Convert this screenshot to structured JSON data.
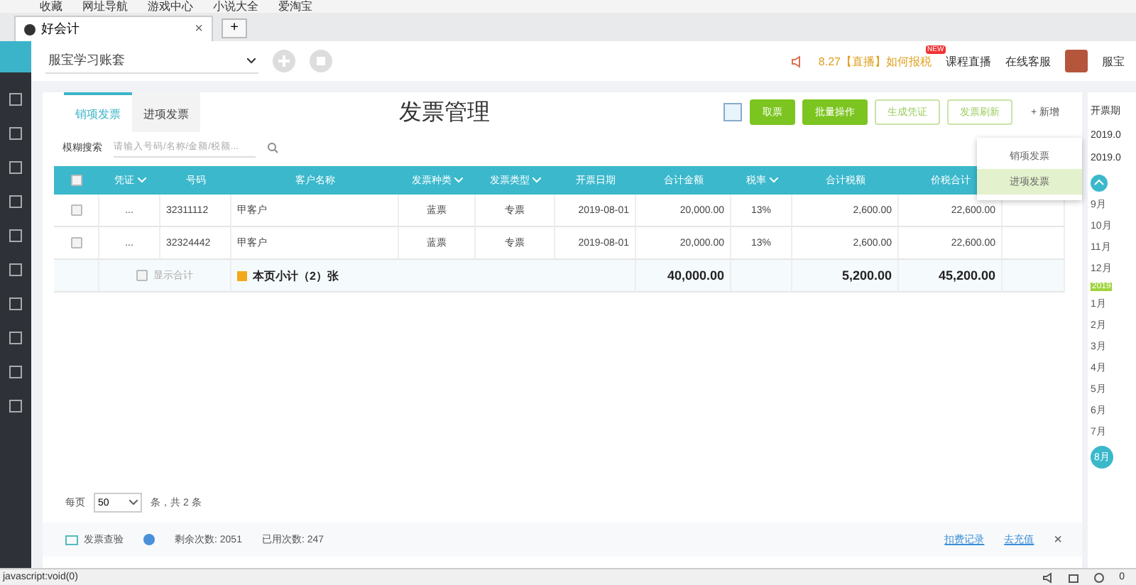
{
  "bookmarks": [
    "收藏",
    "网址导航",
    "游戏中心",
    "小说大全",
    "爱淘宝"
  ],
  "browser_tab": {
    "title": "好会计",
    "close": "×",
    "new_tab": "+"
  },
  "header": {
    "account": "服宝学习账套",
    "notice": "8.27【直播】如何报税",
    "course_badge": "NEW",
    "course": "课程直播",
    "service": "在线客服",
    "user": "服宝"
  },
  "invoice_tabs": [
    {
      "label": "销项发票",
      "selected": true
    },
    {
      "label": "进项发票",
      "selected": false
    }
  ],
  "title": "发票管理",
  "toolbar": [
    {
      "label": "取票",
      "kind": "primary"
    },
    {
      "label": "批量操作",
      "kind": "primary"
    },
    {
      "label": "生成凭证",
      "kind": "outline"
    },
    {
      "label": "发票刷新",
      "kind": "outline"
    },
    {
      "label": "+ 新增",
      "kind": "text"
    }
  ],
  "new_menu": [
    {
      "label": "销项发票",
      "selected": false
    },
    {
      "label": "进项发票",
      "selected": true
    }
  ],
  "search": {
    "mode": "模糊搜索",
    "placeholder": "请输入号码/名称/金额/税额..."
  },
  "table": {
    "select_all_checked": false,
    "columns": [
      {
        "kind": "check"
      },
      {
        "label": "凭证",
        "kind": "text",
        "dropdown": true
      },
      {
        "label": "号码",
        "kind": "text",
        "dropdown": false
      },
      {
        "label": "客户名称",
        "kind": "text",
        "dropdown": false
      },
      {
        "label": "发票种类",
        "kind": "text",
        "dropdown": true
      },
      {
        "label": "发票类型",
        "kind": "text",
        "dropdown": true
      },
      {
        "label": "开票日期",
        "kind": "text",
        "dropdown": false
      },
      {
        "label": "合计金额",
        "kind": "text",
        "dropdown": false
      },
      {
        "label": "税率",
        "kind": "text",
        "dropdown": true
      },
      {
        "label": "合计税额",
        "kind": "text",
        "dropdown": false
      },
      {
        "label": "价税合计",
        "kind": "text",
        "dropdown": false
      },
      {
        "kind": "blank"
      }
    ],
    "rows": [
      {
        "checked": false,
        "voucher": "...",
        "number": "32311112",
        "customer": "甲客户",
        "category": "蓝票",
        "type": "专票",
        "date": "2019-08-01",
        "amount": "20,000.00",
        "rate": "13%",
        "tax": "2,600.00",
        "total": "22,600.00"
      },
      {
        "checked": false,
        "voucher": "...",
        "number": "32324442",
        "customer": "甲客户",
        "category": "蓝票",
        "type": "专票",
        "date": "2019-08-01",
        "amount": "20,000.00",
        "rate": "13%",
        "tax": "2,600.00",
        "total": "22,600.00"
      }
    ],
    "subtotal": {
      "show_total": {
        "label": "显示合计",
        "checked": false
      },
      "label": "本页小计（2）张",
      "amount": "40,000.00",
      "tax": "5,200.00",
      "total": "45,200.00"
    }
  },
  "pagination": {
    "per_page_label": "每页",
    "per_page": "50",
    "summary": "条，共 2 条"
  },
  "verify_bar": {
    "title": "发票查验",
    "remaining": "剩余次数: 2051",
    "used": "已用次数: 247",
    "links": [
      "扣费记录",
      "去充值"
    ],
    "close": "×"
  },
  "period": {
    "label": "开票期",
    "dates": [
      "2019.0",
      "2019.0"
    ],
    "timeline": [
      {
        "kind": "month",
        "label": "9月",
        "selected": false
      },
      {
        "kind": "month",
        "label": "10月",
        "selected": false
      },
      {
        "kind": "month",
        "label": "11月",
        "selected": false
      },
      {
        "kind": "month",
        "label": "12月",
        "selected": false
      },
      {
        "kind": "year",
        "label": "2019"
      },
      {
        "kind": "month",
        "label": "1月",
        "selected": false
      },
      {
        "kind": "month",
        "label": "2月",
        "selected": false
      },
      {
        "kind": "month",
        "label": "3月",
        "selected": false
      },
      {
        "kind": "month",
        "label": "4月",
        "selected": false
      },
      {
        "kind": "month",
        "label": "5月",
        "selected": false
      },
      {
        "kind": "month",
        "label": "6月",
        "selected": false
      },
      {
        "kind": "month",
        "label": "7月",
        "selected": false
      },
      {
        "kind": "month",
        "label": "8月",
        "selected": true
      }
    ]
  },
  "status_bar": {
    "text": "javascript:void(0)",
    "count": "0"
  }
}
